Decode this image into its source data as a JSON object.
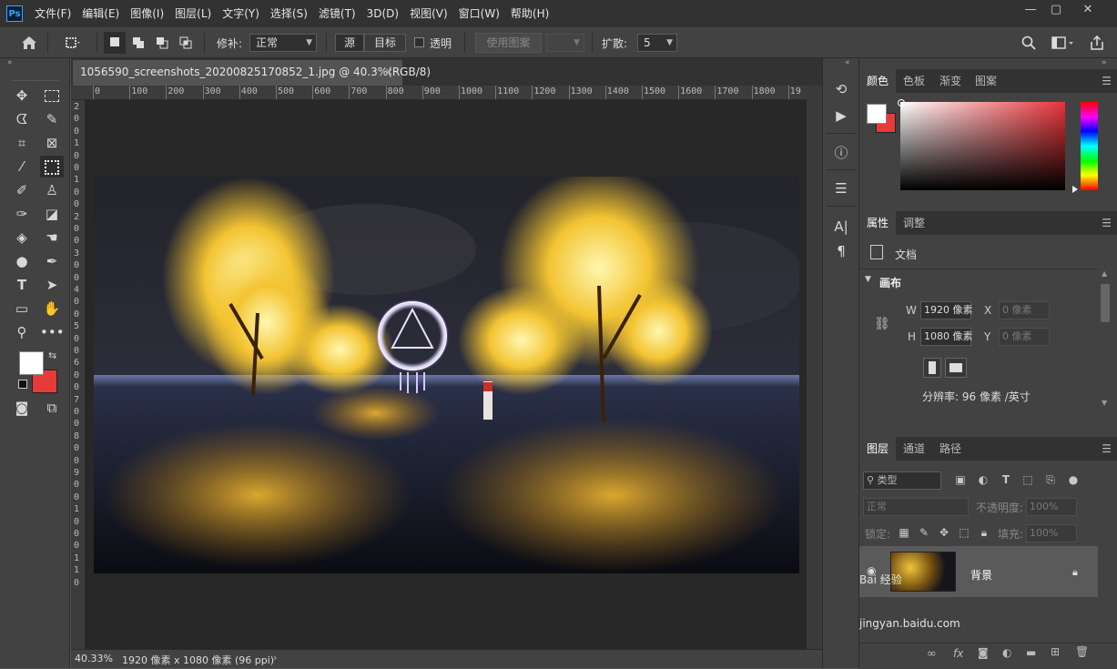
{
  "app": {
    "logo": "Ps"
  },
  "menu": [
    "文件(F)",
    "编辑(E)",
    "图像(I)",
    "图层(L)",
    "文字(Y)",
    "选择(S)",
    "滤镜(T)",
    "3D(D)",
    "视图(V)",
    "窗口(W)",
    "帮助(H)"
  ],
  "options": {
    "patch_label": "修补:",
    "patch_mode": "正常",
    "source_label": "源",
    "target_label": "目标",
    "transparent_label": "透明",
    "use_pattern_label": "使用图案",
    "diffusion_label": "扩散:",
    "diffusion_value": "5"
  },
  "document": {
    "tab_title": "1056590_screenshots_20200825170852_1.jpg @ 40.3%(RGB/8)",
    "tab_close": "×",
    "zoom": "40.33%",
    "status": "1920 像素 x 1080 像素 (96 ppi)",
    "status_arrow": "›"
  },
  "rulers": {
    "top": [
      "0",
      "100",
      "200",
      "300",
      "400",
      "500",
      "600",
      "700",
      "800",
      "900",
      "1000",
      "1100",
      "1200",
      "1300",
      "1400",
      "1500",
      "1600",
      "1700",
      "1800",
      "19"
    ],
    "left": [
      "2",
      "0",
      "0",
      "1",
      "0",
      "0",
      "1",
      "0",
      "0",
      "2",
      "0",
      "0",
      "3",
      "0",
      "0",
      "4",
      "0",
      "0",
      "5",
      "0",
      "0",
      "6",
      "0",
      "0",
      "7",
      "0",
      "0",
      "8",
      "0",
      "0",
      "9",
      "0",
      "0",
      "1",
      "0",
      "0",
      "0",
      "1",
      "1",
      "0"
    ]
  },
  "color_panel": {
    "tabs": [
      "颜色",
      "色板",
      "渐变",
      "图案"
    ],
    "fg_color": "#ffffff",
    "bg_color": "#e73a3a",
    "hue_color": "#e8343a"
  },
  "properties_panel": {
    "tabs": [
      "属性",
      "调整"
    ],
    "doc_label": "文档",
    "section": "画布",
    "w_label": "W",
    "w_value": "1920 像素",
    "h_label": "H",
    "h_value": "1080 像素",
    "x_label": "X",
    "x_value": "0 像素",
    "y_label": "Y",
    "y_value": "0 像素",
    "resolution": "分辨率: 96 像素 /英寸"
  },
  "layers_panel": {
    "tabs": [
      "图层",
      "通道",
      "路径"
    ],
    "filter_label": "类型",
    "blend_mode": "正常",
    "opacity_label": "不透明度:",
    "opacity_value": "100%",
    "lock_label": "锁定:",
    "fill_label": "填充:",
    "fill_value": "100%",
    "layer_name": "背景"
  },
  "watermark": {
    "line1": "Bai 经验",
    "line2": "jingyan.baidu.com"
  }
}
